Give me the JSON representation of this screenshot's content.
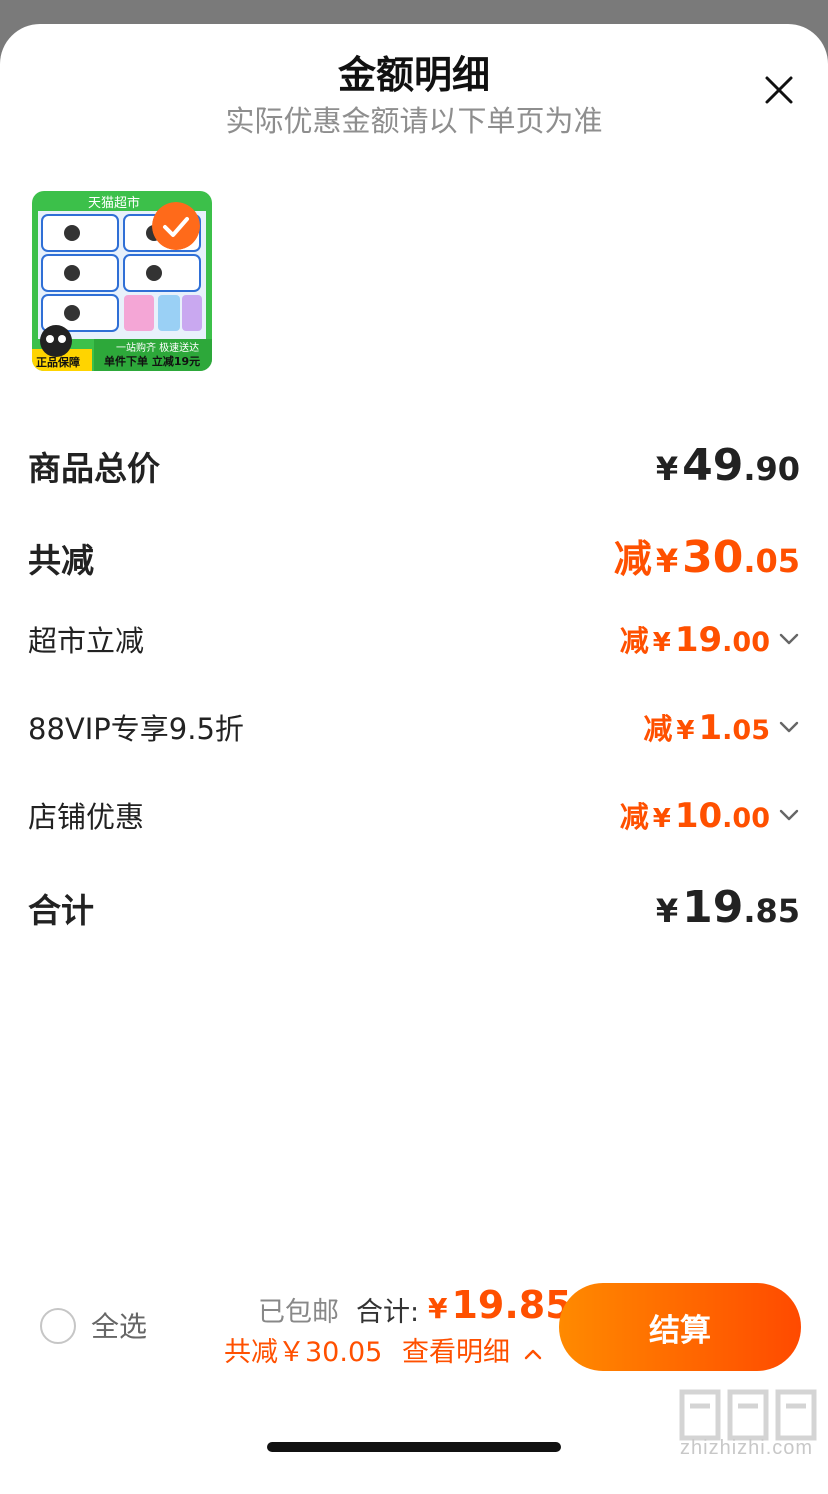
{
  "header": {
    "title": "金额明细",
    "subtitle": "实际优惠金额请以下单页为准"
  },
  "product": {
    "tag_top": "天猫超市",
    "banner_line1": "一站购齐 极速送达",
    "banner_line2": "单件下单 立减19元",
    "corner_badge": "正品保障",
    "selected": true
  },
  "summary": {
    "subtotal": {
      "label": "商品总价",
      "currency": "¥",
      "int": "49",
      "dec": ".90"
    },
    "total_discount": {
      "label": "共减",
      "prefix": "减",
      "currency": "¥",
      "int": "30",
      "dec": ".05"
    },
    "discounts": [
      {
        "label": "超市立减",
        "prefix": "减",
        "currency": "¥",
        "int": "19",
        "dec": ".00"
      },
      {
        "label": "88VIP专享9.5折",
        "prefix": "减",
        "currency": "¥",
        "int": "1",
        "dec": ".05"
      },
      {
        "label": "店铺优惠",
        "prefix": "减",
        "currency": "¥",
        "int": "10",
        "dec": ".00"
      }
    ],
    "total": {
      "label": "合计",
      "currency": "¥",
      "int": "19",
      "dec": ".85"
    }
  },
  "footer": {
    "select_all": "全选",
    "shipping": "已包邮",
    "total_label": "合计:",
    "currency": "¥",
    "total_value": "19.85",
    "saved_text": "共减￥30.05",
    "details_link": "查看明细",
    "checkout_label": "结算"
  },
  "watermark": {
    "text": "zhizhizhi.com"
  },
  "colors": {
    "accent": "#ff5000",
    "text": "#222222",
    "muted": "#8e8e8e"
  },
  "icons": [
    "close-icon",
    "check-icon",
    "chevron-down-icon",
    "chevron-up-icon",
    "radio-icon"
  ]
}
